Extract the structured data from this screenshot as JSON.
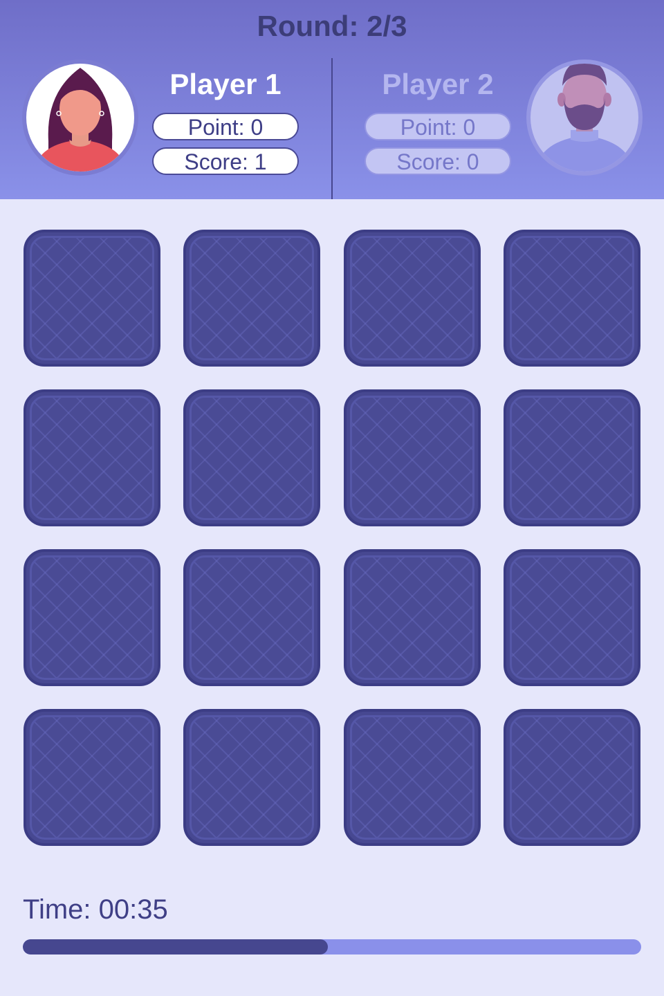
{
  "round": {
    "label": "Round: 2/3"
  },
  "players": [
    {
      "name": "Player 1",
      "point": "Point: 0",
      "score": "Score: 1",
      "active": true,
      "avatar": "woman-avatar"
    },
    {
      "name": "Player 2",
      "point": "Point: 0",
      "score": "Score: 0",
      "active": false,
      "avatar": "bearded-man-avatar"
    }
  ],
  "board": {
    "rows": 4,
    "cols": 4,
    "cards": [
      {
        "state": "face-down"
      },
      {
        "state": "face-down"
      },
      {
        "state": "face-down"
      },
      {
        "state": "face-down"
      },
      {
        "state": "face-down"
      },
      {
        "state": "face-down"
      },
      {
        "state": "face-down"
      },
      {
        "state": "face-down"
      },
      {
        "state": "face-down"
      },
      {
        "state": "face-down"
      },
      {
        "state": "face-down"
      },
      {
        "state": "face-down"
      },
      {
        "state": "face-down"
      },
      {
        "state": "face-down"
      },
      {
        "state": "face-down"
      },
      {
        "state": "face-down"
      }
    ]
  },
  "timer": {
    "label": "Time: 00:35",
    "progress": 0.493
  },
  "colors": {
    "header_top": "#6f6ec8",
    "header_bottom": "#8a91e9",
    "background": "#e6e7fb",
    "card_back": "#474891",
    "progress_fill": "#46478f",
    "progress_track": "#8a90ea"
  }
}
